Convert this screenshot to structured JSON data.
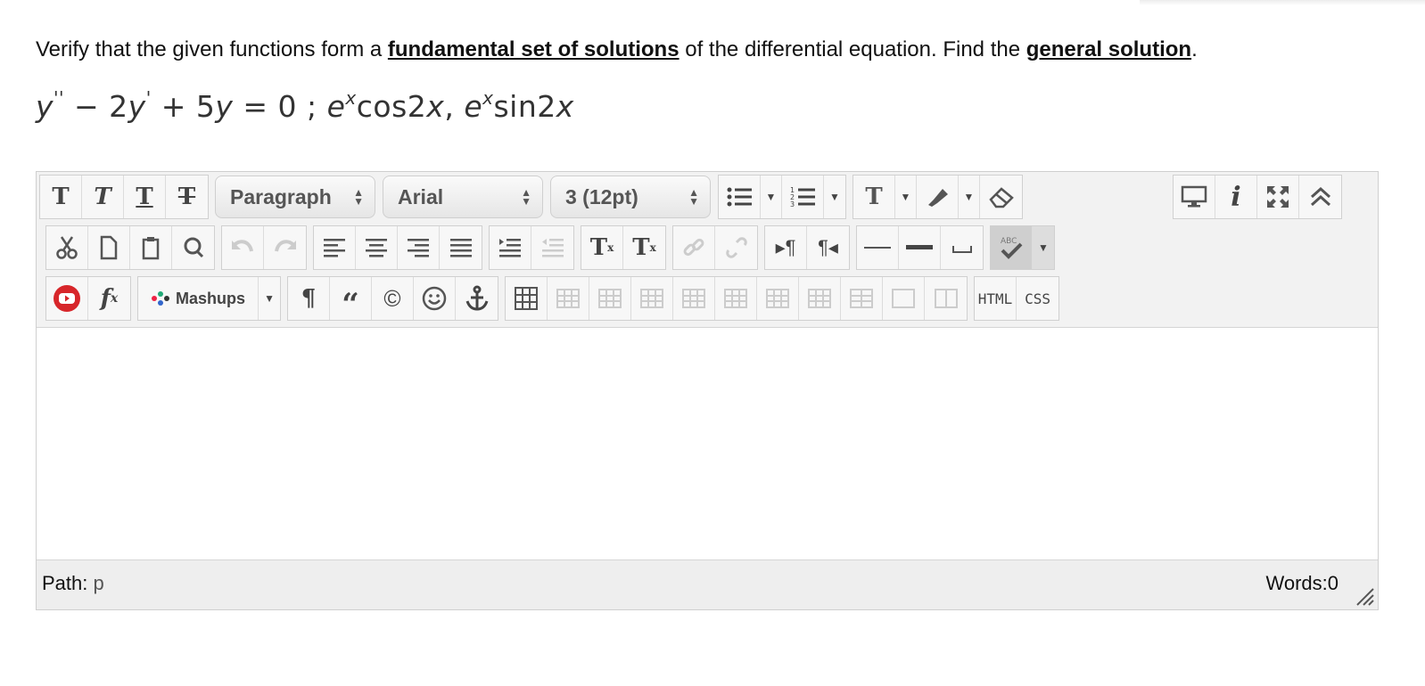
{
  "question": {
    "intro": "Verify that the given functions form a ",
    "link1": "fundamental set of solutions",
    "middle": " of the differential equation. Find the ",
    "link2": "general solution",
    "end": "."
  },
  "equation": {
    "y": "y",
    "pp": "''",
    "minus": " − 2",
    "y2": "y",
    "p": "'",
    "plus": " + 5",
    "y3": "y",
    "eq": " = 0  ;  ",
    "e1": "e",
    "x1": "x",
    "cos": "cos2",
    "xcos": "x",
    "comma": ",  ",
    "e2": "e",
    "x2": "x",
    "sin": "sin2",
    "xsin": "x"
  },
  "toolbar": {
    "bold": "T",
    "italic": "T",
    "underline": "T",
    "strike": "T",
    "format_select": "Paragraph",
    "font_select": "Arial",
    "size_select": "3 (12pt)",
    "text_color": "T",
    "superscript": "T",
    "subscript": "T",
    "mashups_label": "Mashups",
    "paragraph_mark": "¶",
    "quote": "“",
    "copyright": "©",
    "html_label": "HTML",
    "css_label": "CSS",
    "fx": "f",
    "fx_sub": "x",
    "sup_x": "x",
    "sub_x": "x",
    "spell_abc": "ABC"
  },
  "statusbar": {
    "path_label": "Path:",
    "path_value": "p",
    "words": "Words:0"
  },
  "colors": {
    "toolbar_bg": "#f2f2f2",
    "icon": "#444444",
    "disabled_icon": "#c3c3c3",
    "youtube_red": "#d7262a"
  }
}
